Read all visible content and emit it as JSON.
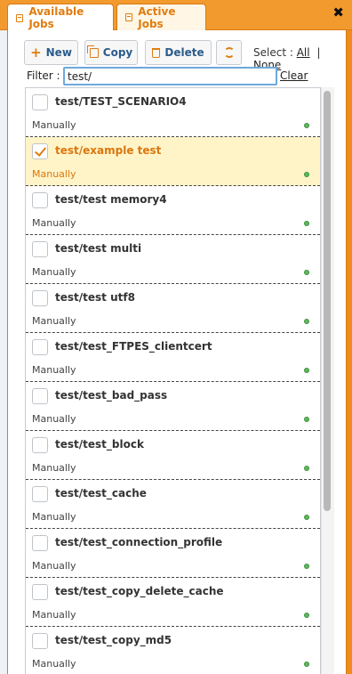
{
  "tabs": [
    {
      "label": "Available Jobs",
      "active": true
    },
    {
      "label": "Active Jobs",
      "active": false
    }
  ],
  "close_icon": "✖",
  "toolbar": {
    "new_label": "New",
    "copy_label": "Copy",
    "delete_label": "Delete",
    "refresh_icon": "refresh-icon"
  },
  "select": {
    "label": "Select :",
    "all": "All",
    "separator": "|",
    "none": "None"
  },
  "filter": {
    "label": "Filter :",
    "value": "test/",
    "clear": "Clear"
  },
  "colors": {
    "accent": "#f29a2e",
    "selected_row": "#fff4c8",
    "status_dot": "#5cb85c"
  },
  "jobs": [
    {
      "name": "test/TEST_SCENARIO4",
      "schedule": "Manually",
      "checked": false
    },
    {
      "name": "test/example test",
      "schedule": "Manually",
      "checked": true
    },
    {
      "name": "test/test memory4",
      "schedule": "Manually",
      "checked": false
    },
    {
      "name": "test/test multi",
      "schedule": "Manually",
      "checked": false
    },
    {
      "name": "test/test utf8",
      "schedule": "Manually",
      "checked": false
    },
    {
      "name": "test/test_FTPES_clientcert",
      "schedule": "Manually",
      "checked": false
    },
    {
      "name": "test/test_bad_pass",
      "schedule": "Manually",
      "checked": false
    },
    {
      "name": "test/test_block",
      "schedule": "Manually",
      "checked": false
    },
    {
      "name": "test/test_cache",
      "schedule": "Manually",
      "checked": false
    },
    {
      "name": "test/test_connection_profile",
      "schedule": "Manually",
      "checked": false
    },
    {
      "name": "test/test_copy_delete_cache",
      "schedule": "Manually",
      "checked": false
    },
    {
      "name": "test/test_copy_md5",
      "schedule": "Manually",
      "checked": false
    }
  ]
}
